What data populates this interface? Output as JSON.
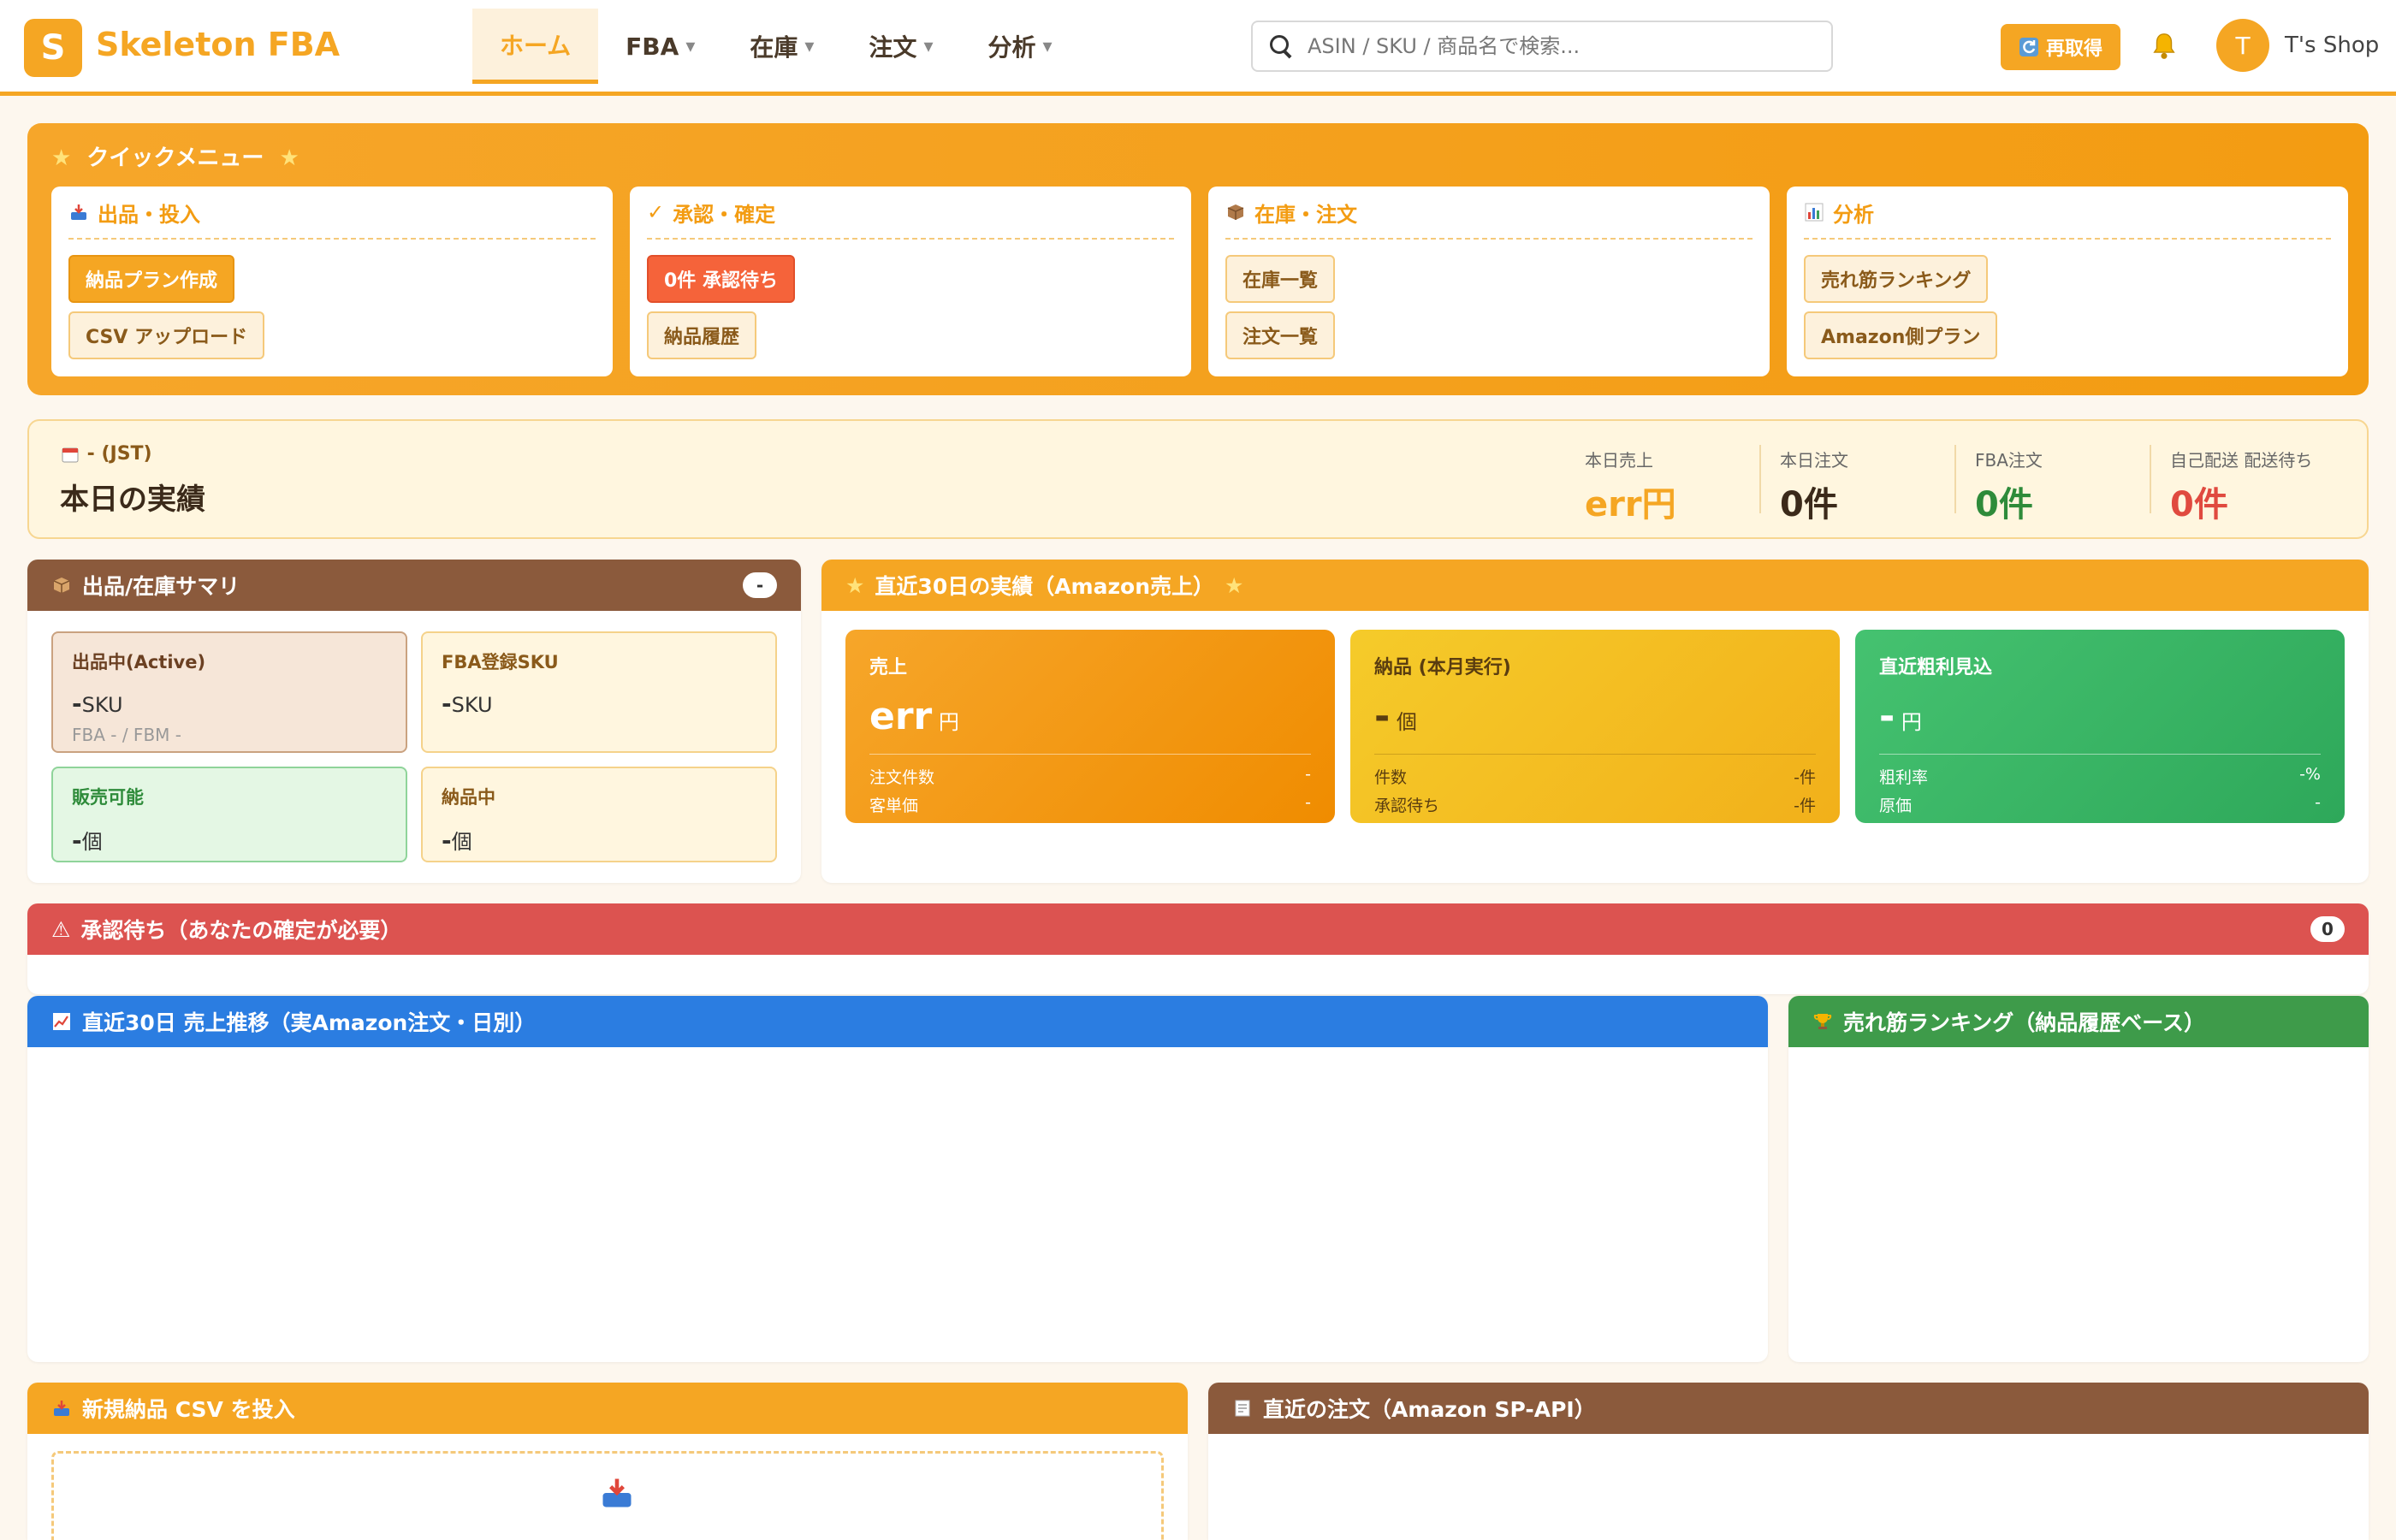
{
  "header": {
    "logo_letter": "S",
    "app_name": "Skeleton FBA",
    "nav": [
      {
        "label": "ホーム",
        "caret": ""
      },
      {
        "label": "FBA",
        "caret": "▾"
      },
      {
        "label": "在庫",
        "caret": "▾"
      },
      {
        "label": "注文",
        "caret": "▾"
      },
      {
        "label": "分析",
        "caret": "▾"
      }
    ],
    "search_placeholder": "ASIN / SKU / 商品名で検索...",
    "refresh_label": "再取得",
    "avatar_letter": "T",
    "shop_name": "T's Shop"
  },
  "quick_menu": {
    "title": "クイックメニュー",
    "cards": [
      {
        "title": "出品・投入",
        "buttons": [
          "納品プラン作成",
          "CSV アップロード"
        ]
      },
      {
        "title": "承認・確定",
        "buttons": [
          "0件 承認待ち",
          "納品履歴"
        ]
      },
      {
        "title": "在庫・注文",
        "buttons": [
          "在庫一覧",
          "注文一覧"
        ]
      },
      {
        "title": "分析",
        "buttons": [
          "売れ筋ランキング",
          "Amazon側プラン"
        ]
      }
    ]
  },
  "today": {
    "date": "- (JST)",
    "title": "本日の実績",
    "kpis": [
      {
        "label": "本日売上",
        "value": "err円",
        "color": "#f5a623"
      },
      {
        "label": "本日注文",
        "value": "0件",
        "color": "#3b2a1a"
      },
      {
        "label": "FBA注文",
        "value": "0件",
        "color": "#2e8b3a"
      },
      {
        "label": "自己配送 配送待ち",
        "value": "0件",
        "color": "#e04a3f"
      }
    ]
  },
  "stock_summary": {
    "title": "出品/在庫サマリ",
    "badge": "-",
    "cards": [
      {
        "title": "出品中(Active)",
        "value": "-",
        "unit": "SKU",
        "sub": "FBA - / FBM -"
      },
      {
        "title": "FBA登録SKU",
        "value": "-",
        "unit": "SKU",
        "sub": ""
      },
      {
        "title": "販売可能",
        "value": "-",
        "unit": "個",
        "sub": ""
      },
      {
        "title": "納品中",
        "value": "-",
        "unit": "個",
        "sub": ""
      }
    ]
  },
  "recent30": {
    "title": "直近30日の実績（Amazon売上）",
    "cards": [
      {
        "title": "売上",
        "value": "err",
        "unit": "円",
        "rows": [
          [
            "注文件数",
            "-"
          ],
          [
            "客単価",
            "-"
          ]
        ]
      },
      {
        "title": "納品 (本月実行)",
        "value": "-",
        "unit": "個",
        "rows": [
          [
            "件数",
            "-件"
          ],
          [
            "承認待ち",
            "-件"
          ]
        ]
      },
      {
        "title": "直近粗利見込",
        "value": "-",
        "unit": "円",
        "rows": [
          [
            "粗利率",
            "-%"
          ],
          [
            "原価",
            "-"
          ]
        ]
      }
    ]
  },
  "approval": {
    "title": "承認待ち（あなたの確定が必要）",
    "badge": "0"
  },
  "sales_trend": {
    "title": "直近30日 売上推移（実Amazon注文・日別）"
  },
  "ranking": {
    "title": "売れ筋ランキング（納品履歴ベース）"
  },
  "csv_upload": {
    "title": "新規納品 CSV を投入"
  },
  "recent_orders": {
    "title": "直近の注文（Amazon SP-API）"
  },
  "colors": {
    "orange": "#f5a623",
    "brown": "#8b5a3c",
    "red": "#dc5350",
    "blue": "#2b7de1",
    "green": "#3e9b4a"
  }
}
